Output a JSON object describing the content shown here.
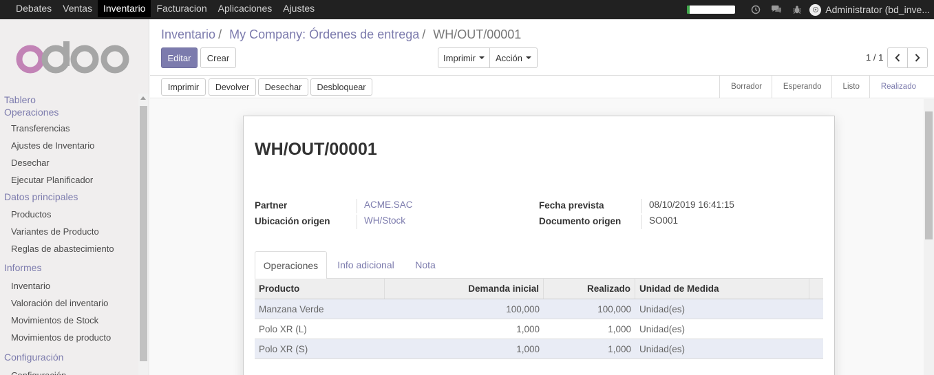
{
  "topbar": {
    "menu": [
      {
        "label": "Debates",
        "active": false
      },
      {
        "label": "Ventas",
        "active": false
      },
      {
        "label": "Inventario",
        "active": true
      },
      {
        "label": "Facturacion",
        "active": false
      },
      {
        "label": "Aplicaciones",
        "active": false
      },
      {
        "label": "Ajustes",
        "active": false
      }
    ],
    "progress": 0.05,
    "icons": [
      "clock-icon",
      "chat-icon",
      "bug-icon"
    ],
    "user": "Administrator (bd_inve..."
  },
  "sidebar": {
    "logo": "odoo",
    "dashboard": "Tablero",
    "sections": [
      {
        "title": "Operaciones",
        "items": [
          "Transferencias",
          "Ajustes de Inventario",
          "Desechar",
          "Ejecutar Planificador"
        ]
      },
      {
        "title": "Datos principales",
        "items": [
          "Productos",
          "Variantes de Producto",
          "Reglas de abastecimiento"
        ]
      },
      {
        "title": "Informes",
        "items": [
          "Inventario",
          "Valoración del inventario",
          "Movimientos de Stock",
          "Movimientos de producto"
        ]
      },
      {
        "title": "Configuración",
        "items": [
          "Configuración"
        ]
      }
    ]
  },
  "breadcrumb": {
    "items": [
      "Inventario",
      "My Company: Órdenes de entrega"
    ],
    "current": "WH/OUT/00001"
  },
  "buttons": {
    "edit": "Editar",
    "create": "Crear",
    "print": "Imprimir",
    "action": "Acción"
  },
  "pager": {
    "value": "1 / 1"
  },
  "statusbar": {
    "buttons": [
      "Imprimir",
      "Devolver",
      "Desechar",
      "Desbloquear"
    ],
    "stages": [
      "Borrador",
      "Esperando",
      "Listo",
      "Realizado"
    ],
    "active_stage": "Realizado"
  },
  "record": {
    "name": "WH/OUT/00001",
    "fields": {
      "partner_label": "Partner",
      "partner_value": "ACME.SAC",
      "origin_location_label": "Ubicación origen",
      "origin_location_value": "WH/Stock",
      "date_label": "Fecha prevista",
      "date_value": "08/10/2019 16:41:15",
      "source_doc_label": "Documento origen",
      "source_doc_value": "SO001"
    }
  },
  "tabs": [
    {
      "label": "Operaciones",
      "active": true
    },
    {
      "label": "Info adicional",
      "active": false
    },
    {
      "label": "Nota",
      "active": false
    }
  ],
  "table": {
    "headers": [
      "Producto",
      "Demanda inicial",
      "Realizado",
      "Unidad de Medida"
    ],
    "rows": [
      [
        "Manzana Verde",
        "100,000",
        "100,000",
        "Unidad(es)"
      ],
      [
        "Polo XR (L)",
        "1,000",
        "1,000",
        "Unidad(es)"
      ],
      [
        "Polo XR (S)",
        "1,000",
        "1,000",
        "Unidad(es)"
      ]
    ]
  },
  "colors": {
    "brand": "#7c7bad",
    "topbar": "#212121",
    "progress": "#3ea649"
  }
}
